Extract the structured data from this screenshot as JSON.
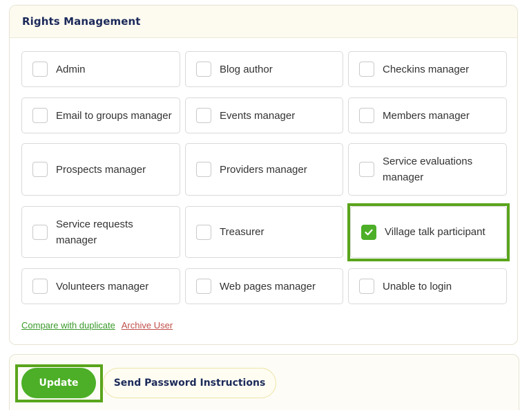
{
  "rights": {
    "title": "Rights Management",
    "options": [
      {
        "label": "Admin",
        "checked": false
      },
      {
        "label": "Blog author",
        "checked": false
      },
      {
        "label": "Checkins manager",
        "checked": false
      },
      {
        "label": "Email to groups manager",
        "checked": false
      },
      {
        "label": "Events manager",
        "checked": false
      },
      {
        "label": "Members manager",
        "checked": false
      },
      {
        "label": "Prospects manager",
        "checked": false
      },
      {
        "label": "Providers manager",
        "checked": false
      },
      {
        "label": "Service evaluations manager",
        "checked": false
      },
      {
        "label": "Service requests manager",
        "checked": false
      },
      {
        "label": "Treasurer",
        "checked": false
      },
      {
        "label": "Village talk participant",
        "checked": true
      },
      {
        "label": "Volunteers manager",
        "checked": false
      },
      {
        "label": "Web pages manager",
        "checked": false
      },
      {
        "label": "Unable to login",
        "checked": false
      }
    ],
    "links": {
      "compare": "Compare with duplicate",
      "archive": "Archive User"
    }
  },
  "actions": {
    "update_label": "Update",
    "send_password_label": "Send Password Instructions"
  },
  "colors": {
    "accent_green": "#4caf27",
    "highlight_green": "#5aa51c",
    "title_navy": "#1c2a5a",
    "archive_red": "#c0504a"
  }
}
